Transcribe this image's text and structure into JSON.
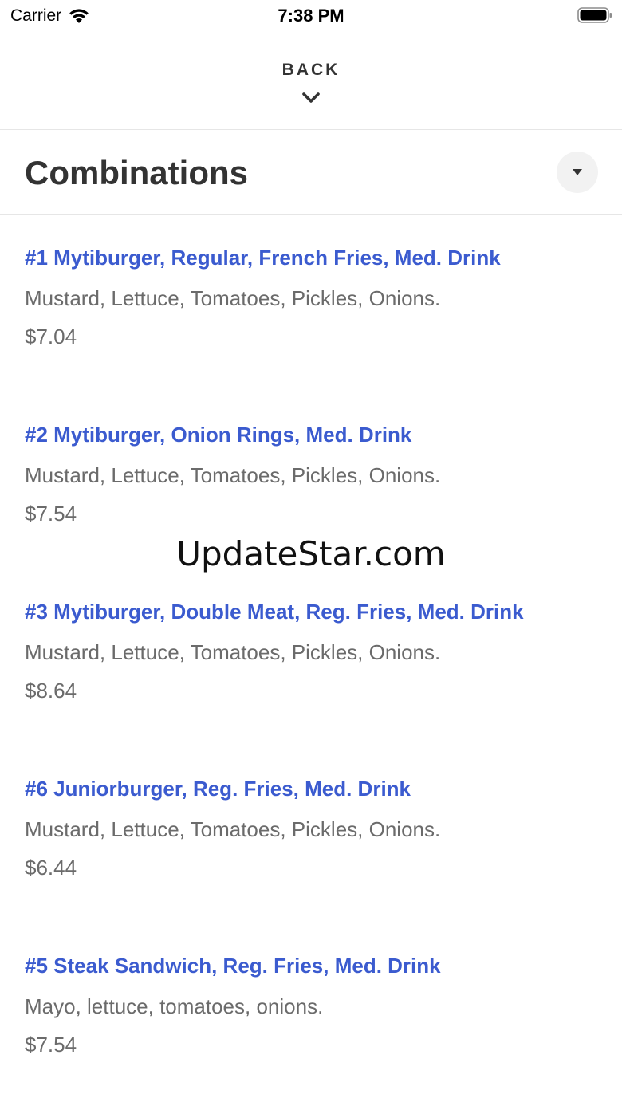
{
  "status_bar": {
    "carrier": "Carrier",
    "time": "7:38 PM",
    "icons": [
      "wifi-icon",
      "battery-icon"
    ]
  },
  "header": {
    "back_label": "BACK",
    "back_icon": "chevron-down-icon"
  },
  "section": {
    "title": "Combinations",
    "toggle_icon": "caret-down-icon"
  },
  "items": [
    {
      "name": "#1 Mytiburger, Regular, French Fries, Med. Drink",
      "description": "Mustard, Lettuce, Tomatoes, Pickles, Onions.",
      "price": "$7.04"
    },
    {
      "name": "#2 Mytiburger, Onion Rings, Med. Drink",
      "description": "Mustard, Lettuce, Tomatoes, Pickles, Onions.",
      "price": "$7.54"
    },
    {
      "name": "#3 Mytiburger, Double Meat, Reg. Fries, Med. Drink",
      "description": "Mustard, Lettuce, Tomatoes, Pickles, Onions.",
      "price": "$8.64"
    },
    {
      "name": "#6 Juniorburger, Reg. Fries, Med. Drink",
      "description": "Mustard, Lettuce, Tomatoes, Pickles, Onions.",
      "price": "$6.44"
    },
    {
      "name": "#5 Steak Sandwich, Reg. Fries, Med. Drink",
      "description": "Mayo, lettuce, tomatoes, onions.",
      "price": "$7.54"
    }
  ],
  "watermark": "UpdateStar.com",
  "colors": {
    "item_name": "#3b5bcf",
    "text_secondary": "#6b6b6b",
    "title": "#333333",
    "divider": "#e6e6e6"
  }
}
